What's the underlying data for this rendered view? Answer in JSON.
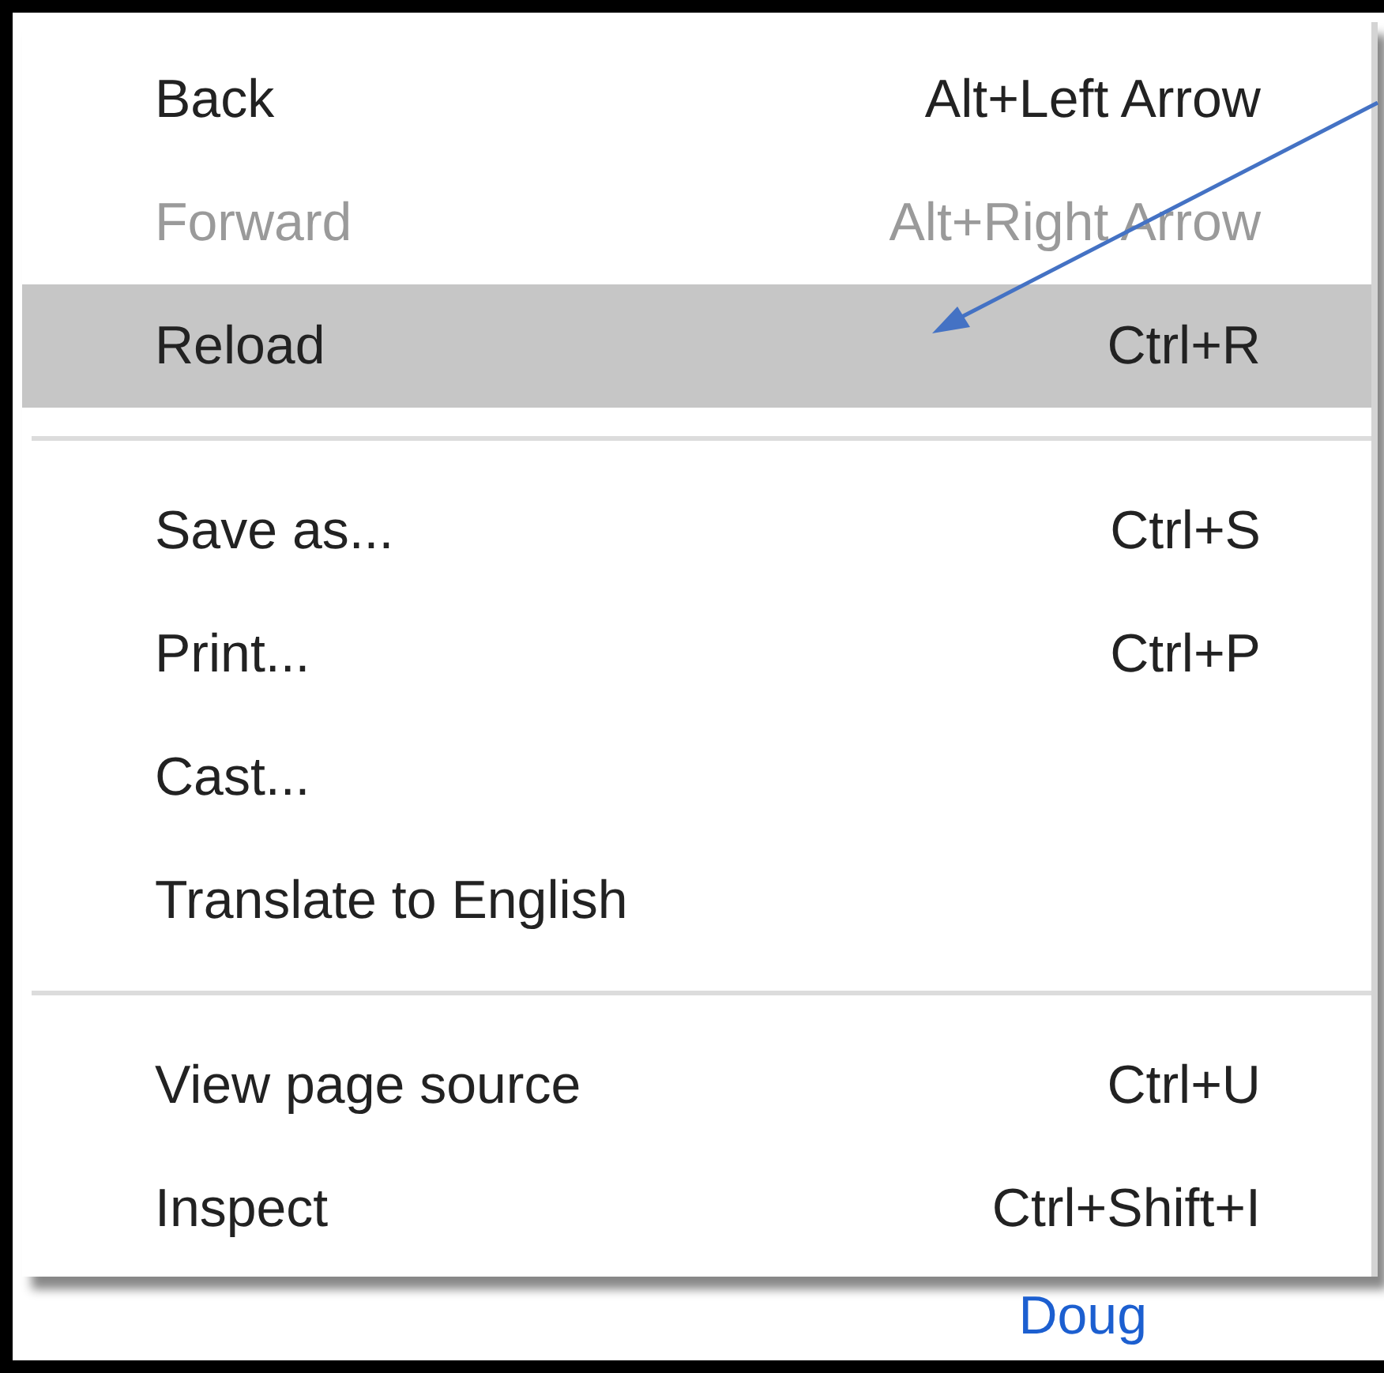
{
  "menu": {
    "sections": [
      {
        "items": [
          {
            "label": "Back",
            "shortcut": "Alt+Left Arrow",
            "disabled": false,
            "selected": false
          },
          {
            "label": "Forward",
            "shortcut": "Alt+Right Arrow",
            "disabled": true,
            "selected": false
          },
          {
            "label": "Reload",
            "shortcut": "Ctrl+R",
            "disabled": false,
            "selected": true
          }
        ]
      },
      {
        "items": [
          {
            "label": "Save as...",
            "shortcut": "Ctrl+S",
            "disabled": false,
            "selected": false
          },
          {
            "label": "Print...",
            "shortcut": "Ctrl+P",
            "disabled": false,
            "selected": false
          },
          {
            "label": "Cast...",
            "disabled": false,
            "selected": false
          },
          {
            "label": "Translate to English",
            "disabled": false,
            "selected": false
          }
        ]
      },
      {
        "items": [
          {
            "label": "View page source",
            "shortcut": "Ctrl+U",
            "disabled": false,
            "selected": false
          },
          {
            "label": "Inspect",
            "shortcut": "Ctrl+Shift+I",
            "disabled": false,
            "selected": false
          }
        ]
      }
    ]
  },
  "background": {
    "link": "Doug"
  }
}
